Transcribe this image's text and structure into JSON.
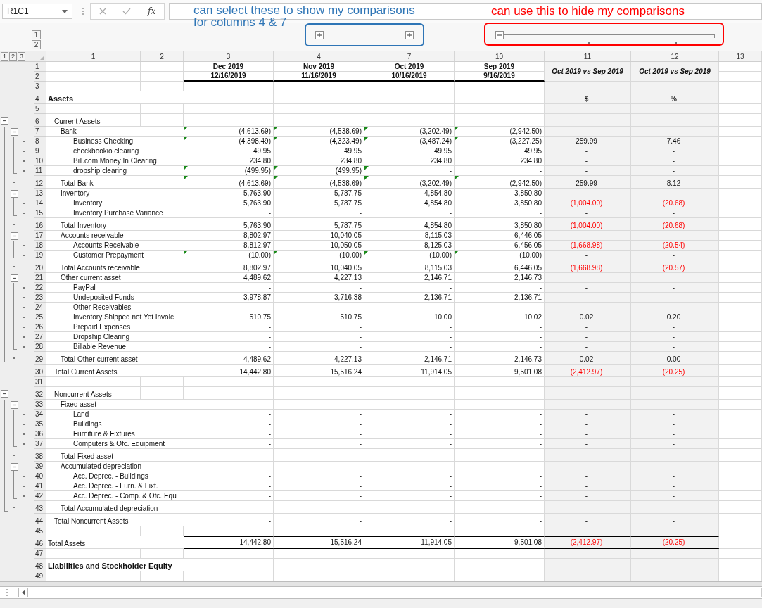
{
  "formula_bar": {
    "name_box": "R1C1",
    "function_label": "fx"
  },
  "annotations": [
    {
      "text": "can select these to show my comparisons\nfor columns 4 & 7",
      "color": "#2e75b6"
    },
    {
      "text": "can use this to hide my comparisons",
      "color": "#ff0000"
    }
  ],
  "column_outline": {
    "levels": [
      "1",
      "2"
    ],
    "groups": [
      {
        "expanded": false
      },
      {
        "expanded": false
      },
      {
        "expanded": true
      }
    ]
  },
  "row_levels": [
    "1",
    "2",
    "3"
  ],
  "columns": [
    "1",
    "2",
    "3",
    "4",
    "7",
    "10",
    "11",
    "12",
    "13"
  ],
  "header": {
    "row_numbers": [
      "1",
      "2"
    ],
    "periods": [
      {
        "month": "Dec 2019",
        "date": "12/16/2019"
      },
      {
        "month": "Nov 2019",
        "date": "11/16/2019"
      },
      {
        "month": "Oct 2019",
        "date": "10/16/2019"
      },
      {
        "month": "Sep 2019",
        "date": "9/16/2019"
      }
    ],
    "comparisons": [
      "Oct 2019 vs Sep 2019",
      "Oct 2019 vs Sep 2019"
    ]
  },
  "rows": [
    {
      "num": "3",
      "kind": "blank"
    },
    {
      "num": "4",
      "kind": "title",
      "label": "Assets",
      "comparison": [
        {
          "text": "$",
          "negative": false
        },
        {
          "text": "%",
          "negative": false
        }
      ]
    },
    {
      "num": "5",
      "kind": "blank"
    },
    {
      "num": "6",
      "kind": "section",
      "label": "Current Assets",
      "expanded": true
    },
    {
      "num": "7",
      "kind": "group",
      "label": "Bank",
      "expanded": true,
      "values": [
        "(4,613.69)",
        "(4,538.69)",
        "(3,202.49)",
        "(2,942.50)"
      ],
      "flags": [
        true,
        true,
        true,
        true
      ]
    },
    {
      "num": "8",
      "kind": "item",
      "label": "Business Checking",
      "values": [
        "(4,398.49)",
        "(4,323.49)",
        "(3,487.24)",
        "(3,227.25)"
      ],
      "flags": [
        true,
        true,
        true,
        true
      ],
      "comparison": [
        {
          "text": "259.99",
          "negative": false
        },
        {
          "text": "7.46",
          "negative": false
        }
      ]
    },
    {
      "num": "9",
      "kind": "item",
      "label": "checkbookio clearing",
      "values": [
        "49.95",
        "49.95",
        "49.95",
        "49.95"
      ],
      "comparison": [
        {
          "text": "-",
          "negative": false
        },
        {
          "text": "-",
          "negative": false
        }
      ]
    },
    {
      "num": "10",
      "kind": "item",
      "label": "Bill.com Money In Clearing",
      "values": [
        "234.80",
        "234.80",
        "234.80",
        "234.80"
      ],
      "comparison": [
        {
          "text": "-",
          "negative": false
        },
        {
          "text": "-",
          "negative": false
        }
      ]
    },
    {
      "num": "11",
      "kind": "item",
      "label": "dropship clearing",
      "values": [
        "(499.95)",
        "(499.95)",
        "-",
        "-"
      ],
      "flags": [
        true,
        true,
        true,
        false
      ],
      "comparison": [
        {
          "text": "-",
          "negative": false
        },
        {
          "text": "-",
          "negative": false
        }
      ]
    },
    {
      "num": "12",
      "kind": "group-total",
      "label": "Total Bank",
      "values": [
        "(4,613.69)",
        "(4,538.69)",
        "(3,202.49)",
        "(2,942.50)"
      ],
      "flags": [
        true,
        true,
        true,
        true
      ],
      "comparison": [
        {
          "text": "259.99",
          "negative": false
        },
        {
          "text": "8.12",
          "negative": false
        }
      ]
    },
    {
      "num": "13",
      "kind": "group",
      "label": "Inventory",
      "expanded": true,
      "values": [
        "5,763.90",
        "5,787.75",
        "4,854.80",
        "3,850.80"
      ]
    },
    {
      "num": "14",
      "kind": "item",
      "label": "Inventory",
      "values": [
        "5,763.90",
        "5,787.75",
        "4,854.80",
        "3,850.80"
      ],
      "comparison": [
        {
          "text": "(1,004.00)",
          "negative": true
        },
        {
          "text": "(20.68)",
          "negative": true
        }
      ]
    },
    {
      "num": "15",
      "kind": "item",
      "label": "Inventory Purchase Variance",
      "values": [
        "-",
        "-",
        "-",
        "-"
      ],
      "comparison": [
        {
          "text": "-",
          "negative": false
        },
        {
          "text": "-",
          "negative": false
        }
      ]
    },
    {
      "num": "16",
      "kind": "group-total",
      "label": "Total Inventory",
      "values": [
        "5,763.90",
        "5,787.75",
        "4,854.80",
        "3,850.80"
      ],
      "comparison": [
        {
          "text": "(1,004.00)",
          "negative": true
        },
        {
          "text": "(20.68)",
          "negative": true
        }
      ]
    },
    {
      "num": "17",
      "kind": "group",
      "label": "Accounts receivable",
      "expanded": true,
      "values": [
        "8,802.97",
        "10,040.05",
        "8,115.03",
        "6,446.05"
      ]
    },
    {
      "num": "18",
      "kind": "item",
      "label": "Accounts Receivable",
      "values": [
        "8,812.97",
        "10,050.05",
        "8,125.03",
        "6,456.05"
      ],
      "comparison": [
        {
          "text": "(1,668.98)",
          "negative": true
        },
        {
          "text": "(20.54)",
          "negative": true
        }
      ]
    },
    {
      "num": "19",
      "kind": "item",
      "label": "Customer Prepayment",
      "values": [
        "(10.00)",
        "(10.00)",
        "(10.00)",
        "(10.00)"
      ],
      "flags": [
        true,
        true,
        true,
        true
      ],
      "comparison": [
        {
          "text": "-",
          "negative": false
        },
        {
          "text": "-",
          "negative": false
        }
      ]
    },
    {
      "num": "20",
      "kind": "group-total",
      "label": "Total Accounts receivable",
      "values": [
        "8,802.97",
        "10,040.05",
        "8,115.03",
        "6,446.05"
      ],
      "comparison": [
        {
          "text": "(1,668.98)",
          "negative": true
        },
        {
          "text": "(20.57)",
          "negative": true
        }
      ]
    },
    {
      "num": "21",
      "kind": "group",
      "label": "Other current asset",
      "expanded": true,
      "values": [
        "4,489.62",
        "4,227.13",
        "2,146.71",
        "2,146.73"
      ]
    },
    {
      "num": "22",
      "kind": "item",
      "label": "PayPal",
      "values": [
        "-",
        "-",
        "-",
        "-"
      ],
      "comparison": [
        {
          "text": "-",
          "negative": false
        },
        {
          "text": "-",
          "negative": false
        }
      ]
    },
    {
      "num": "23",
      "kind": "item",
      "label": "Undeposited Funds",
      "values": [
        "3,978.87",
        "3,716.38",
        "2,136.71",
        "2,136.71"
      ],
      "comparison": [
        {
          "text": "-",
          "negative": false
        },
        {
          "text": "-",
          "negative": false
        }
      ]
    },
    {
      "num": "24",
      "kind": "item",
      "label": "Other Receivables",
      "values": [
        "-",
        "-",
        "-",
        "-"
      ],
      "comparison": [
        {
          "text": "-",
          "negative": false
        },
        {
          "text": "-",
          "negative": false
        }
      ]
    },
    {
      "num": "25",
      "kind": "item",
      "label": "Inventory Shipped not Yet Invoic",
      "values": [
        "510.75",
        "510.75",
        "10.00",
        "10.02"
      ],
      "comparison": [
        {
          "text": "0.02",
          "negative": false
        },
        {
          "text": "0.20",
          "negative": false
        }
      ]
    },
    {
      "num": "26",
      "kind": "item",
      "label": "Prepaid Expenses",
      "values": [
        "-",
        "-",
        "-",
        "-"
      ],
      "comparison": [
        {
          "text": "-",
          "negative": false
        },
        {
          "text": "-",
          "negative": false
        }
      ]
    },
    {
      "num": "27",
      "kind": "item",
      "label": "Dropship Clearing",
      "values": [
        "-",
        "-",
        "-",
        "-"
      ],
      "comparison": [
        {
          "text": "-",
          "negative": false
        },
        {
          "text": "-",
          "negative": false
        }
      ]
    },
    {
      "num": "28",
      "kind": "item",
      "label": "Billable Revenue",
      "values": [
        "-",
        "-",
        "-",
        "-"
      ],
      "comparison": [
        {
          "text": "-",
          "negative": false
        },
        {
          "text": "-",
          "negative": false
        }
      ]
    },
    {
      "num": "29",
      "kind": "group-total",
      "label": "Total Other current asset",
      "values": [
        "4,489.62",
        "4,227.13",
        "2,146.71",
        "2,146.73"
      ],
      "comparison": [
        {
          "text": "0.02",
          "negative": false
        },
        {
          "text": "0.00",
          "negative": false
        }
      ]
    },
    {
      "num": "30",
      "kind": "section-total",
      "rule_above": true,
      "label": "Total Current Assets",
      "values": [
        "14,442.80",
        "15,516.24",
        "11,914.05",
        "9,501.08"
      ],
      "comparison": [
        {
          "text": "(2,412.97)",
          "negative": true
        },
        {
          "text": "(20.25)",
          "negative": true
        }
      ]
    },
    {
      "num": "31",
      "kind": "blank"
    },
    {
      "num": "32",
      "kind": "section",
      "label": "Noncurrent Assets",
      "expanded": true
    },
    {
      "num": "33",
      "kind": "group",
      "label": "Fixed asset",
      "expanded": true,
      "values": [
        "-",
        "-",
        "-",
        "-"
      ]
    },
    {
      "num": "34",
      "kind": "item",
      "label": "Land",
      "values": [
        "-",
        "-",
        "-",
        "-"
      ],
      "comparison": [
        {
          "text": "-",
          "negative": false
        },
        {
          "text": "-",
          "negative": false
        }
      ]
    },
    {
      "num": "35",
      "kind": "item",
      "label": "Buildings",
      "values": [
        "-",
        "-",
        "-",
        "-"
      ],
      "comparison": [
        {
          "text": "-",
          "negative": false
        },
        {
          "text": "-",
          "negative": false
        }
      ]
    },
    {
      "num": "36",
      "kind": "item",
      "label": "Furniture & Fixtures",
      "values": [
        "-",
        "-",
        "-",
        "-"
      ],
      "comparison": [
        {
          "text": "-",
          "negative": false
        },
        {
          "text": "-",
          "negative": false
        }
      ]
    },
    {
      "num": "37",
      "kind": "item",
      "label": "Computers & Ofc. Equipment",
      "values": [
        "-",
        "-",
        "-",
        "-"
      ],
      "comparison": [
        {
          "text": "-",
          "negative": false
        },
        {
          "text": "-",
          "negative": false
        }
      ]
    },
    {
      "num": "38",
      "kind": "group-total",
      "label": "Total Fixed asset",
      "values": [
        "-",
        "-",
        "-",
        "-"
      ],
      "comparison": [
        {
          "text": "-",
          "negative": false
        },
        {
          "text": "-",
          "negative": false
        }
      ]
    },
    {
      "num": "39",
      "kind": "group",
      "label": "Accumulated depreciation",
      "expanded": true,
      "values": [
        "-",
        "-",
        "-",
        "-"
      ]
    },
    {
      "num": "40",
      "kind": "item",
      "label": "Acc. Deprec. - Buildings",
      "values": [
        "-",
        "-",
        "-",
        "-"
      ],
      "comparison": [
        {
          "text": "-",
          "negative": false
        },
        {
          "text": "-",
          "negative": false
        }
      ]
    },
    {
      "num": "41",
      "kind": "item",
      "label": "Acc. Deprec. - Furn. & Fixt.",
      "values": [
        "-",
        "-",
        "-",
        "-"
      ],
      "comparison": [
        {
          "text": "-",
          "negative": false
        },
        {
          "text": "-",
          "negative": false
        }
      ]
    },
    {
      "num": "42",
      "kind": "item",
      "label": "Acc. Deprec. - Comp. & Ofc. Equ",
      "values": [
        "-",
        "-",
        "-",
        "-"
      ],
      "comparison": [
        {
          "text": "-",
          "negative": false
        },
        {
          "text": "-",
          "negative": false
        }
      ]
    },
    {
      "num": "43",
      "kind": "group-total",
      "label": "Total Accumulated depreciation",
      "values": [
        "-",
        "-",
        "-",
        "-"
      ],
      "comparison": [
        {
          "text": "-",
          "negative": false
        },
        {
          "text": "-",
          "negative": false
        }
      ]
    },
    {
      "num": "44",
      "kind": "section-total",
      "rule_above": true,
      "label": "Total Noncurrent Assets",
      "values": [
        "-",
        "-",
        "-",
        "-"
      ],
      "comparison": [
        {
          "text": "-",
          "negative": false
        },
        {
          "text": "-",
          "negative": false
        }
      ]
    },
    {
      "num": "45",
      "kind": "blank"
    },
    {
      "num": "46",
      "kind": "grand-total",
      "rule_above": true,
      "double_rule_below": true,
      "label": "Total Assets",
      "values": [
        "14,442.80",
        "15,516.24",
        "11,914.05",
        "9,501.08"
      ],
      "comparison": [
        {
          "text": "(2,412.97)",
          "negative": true
        },
        {
          "text": "(20.25)",
          "negative": true
        }
      ]
    },
    {
      "num": "47",
      "kind": "blank"
    },
    {
      "num": "48",
      "kind": "title",
      "label": "Liabilities and Stockholder Equity"
    },
    {
      "num": "49",
      "kind": "blank"
    }
  ]
}
